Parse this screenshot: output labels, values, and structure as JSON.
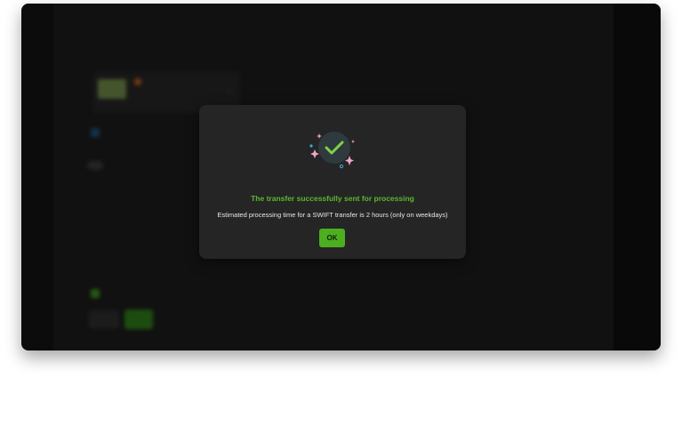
{
  "modal": {
    "title": "The transfer successfully sent for processing",
    "message": "Estimated processing time for a SWIFT transfer is 2 hours (only on weekdays)",
    "ok_label": "OK"
  },
  "colors": {
    "success_green": "#5cb82e",
    "button_green": "#4caf1f",
    "modal_bg": "#252525",
    "sparkle_pink": "#f2a7c9",
    "sparkle_blue": "#3fa9d9"
  },
  "icons": {
    "success": "checkmark-circle-icon",
    "sparkles": "sparkle-icon"
  }
}
